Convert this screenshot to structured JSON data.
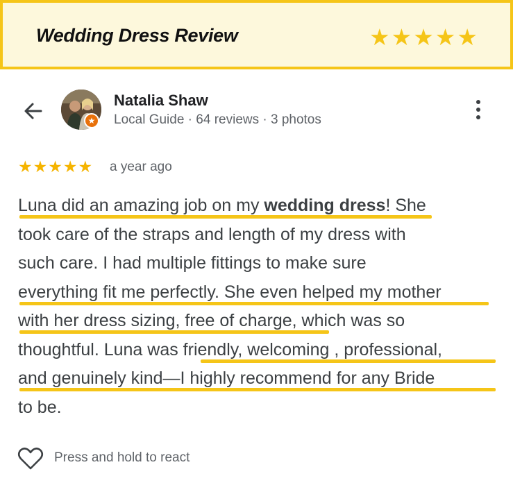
{
  "banner": {
    "title": "Wedding Dress Review",
    "star_count": 5,
    "star_color": "#f5c518"
  },
  "header": {
    "back_icon": "arrow-left-icon",
    "more_icon": "more-vert-icon"
  },
  "reviewer": {
    "name": "Natalia Shaw",
    "meta": "Local Guide · 64 reviews · 3 photos",
    "badge_icon": "local-guide-star-icon"
  },
  "review": {
    "rating": 5,
    "date": "a year ago",
    "lines": [
      {
        "parts": [
          {
            "t": "Luna did an amazing job on my "
          },
          {
            "t": "wedding dress",
            "bold": true
          },
          {
            "t": "! She"
          }
        ]
      },
      {
        "parts": [
          {
            "t": "took care of the straps and length of my dress with"
          }
        ]
      },
      {
        "parts": [
          {
            "t": "such care. I had multiple fittings to make sure"
          }
        ]
      },
      {
        "parts": [
          {
            "t": "everything fit me perfectly. She even helped my mother"
          }
        ]
      },
      {
        "parts": [
          {
            "t": "with her dress sizing, free of charge, which was so"
          }
        ]
      },
      {
        "parts": [
          {
            "t": "thoughtful. Luna was friendly, welcoming , professional,"
          }
        ]
      },
      {
        "parts": [
          {
            "t": "and genuinely kind—I highly recommend for any Bride"
          }
        ]
      },
      {
        "parts": [
          {
            "t": "to be."
          }
        ]
      }
    ],
    "highlight_color": "#f5c518"
  },
  "footer": {
    "react_icon": "heart-outline-icon",
    "react_label": "Press and hold to react"
  }
}
